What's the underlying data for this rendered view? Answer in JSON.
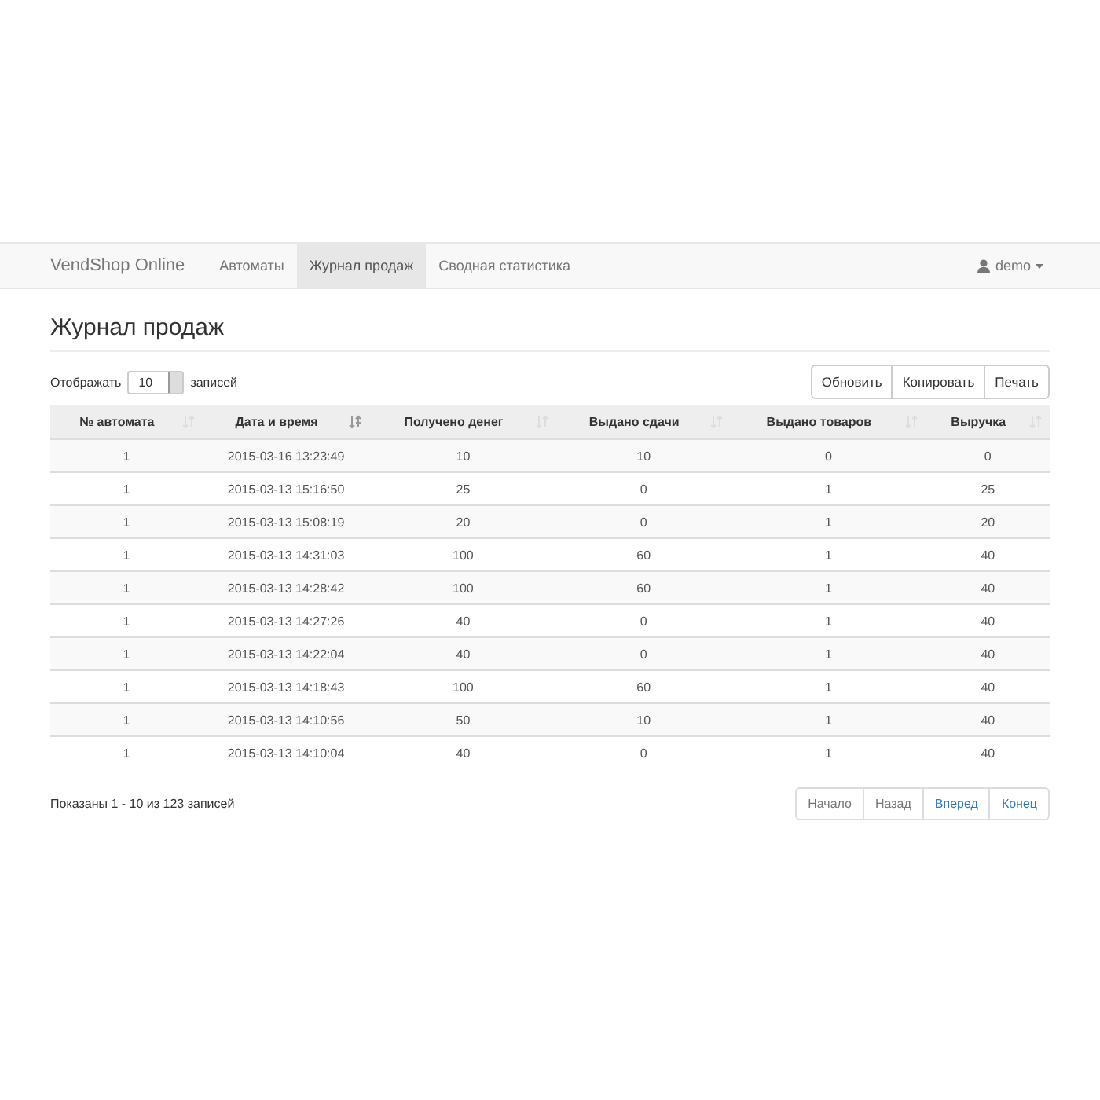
{
  "navbar": {
    "brand": "VendShop Online",
    "items": [
      {
        "label": "Автоматы",
        "selected": false
      },
      {
        "label": "Журнал продаж",
        "selected": true
      },
      {
        "label": "Сводная статистика",
        "selected": false
      }
    ],
    "user": "demo"
  },
  "page_title": "Журнал продаж",
  "length_menu": {
    "prefix": "Отображать",
    "value": "10",
    "suffix": "записей"
  },
  "buttons": [
    "Обновить",
    "Копировать",
    "Печать"
  ],
  "table": {
    "columns": [
      {
        "label": "№ автомата",
        "sorted": false
      },
      {
        "label": "Дата и время",
        "sorted": true
      },
      {
        "label": "Получено денег",
        "sorted": false
      },
      {
        "label": "Выдано сдачи",
        "sorted": false
      },
      {
        "label": "Выдано товаров",
        "sorted": false
      },
      {
        "label": "Выручка",
        "sorted": false
      }
    ],
    "rows": [
      [
        "1",
        "2015-03-16 13:23:49",
        "10",
        "10",
        "0",
        "0"
      ],
      [
        "1",
        "2015-03-13 15:16:50",
        "25",
        "0",
        "1",
        "25"
      ],
      [
        "1",
        "2015-03-13 15:08:19",
        "20",
        "0",
        "1",
        "20"
      ],
      [
        "1",
        "2015-03-13 14:31:03",
        "100",
        "60",
        "1",
        "40"
      ],
      [
        "1",
        "2015-03-13 14:28:42",
        "100",
        "60",
        "1",
        "40"
      ],
      [
        "1",
        "2015-03-13 14:27:26",
        "40",
        "0",
        "1",
        "40"
      ],
      [
        "1",
        "2015-03-13 14:22:04",
        "40",
        "0",
        "1",
        "40"
      ],
      [
        "1",
        "2015-03-13 14:18:43",
        "100",
        "60",
        "1",
        "40"
      ],
      [
        "1",
        "2015-03-13 14:10:56",
        "50",
        "10",
        "1",
        "40"
      ],
      [
        "1",
        "2015-03-13 14:10:04",
        "40",
        "0",
        "1",
        "40"
      ]
    ]
  },
  "info": "Показаны 1 - 10 из 123 записей",
  "pagination": [
    {
      "label": "Начало",
      "disabled": true
    },
    {
      "label": "Назад",
      "disabled": true
    },
    {
      "label": "Вперед",
      "disabled": false
    },
    {
      "label": "Конец",
      "disabled": false
    }
  ]
}
